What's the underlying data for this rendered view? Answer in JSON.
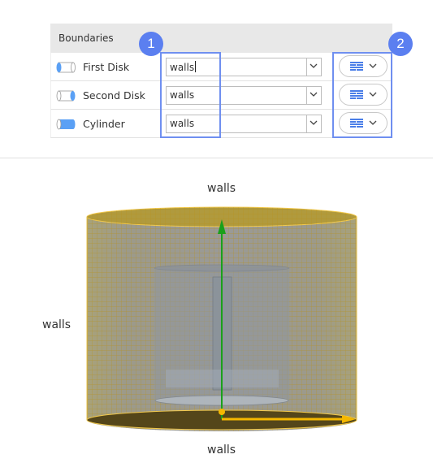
{
  "panel": {
    "header": "Boundaries",
    "rows": [
      {
        "label": "First Disk",
        "icon": "cylinder-first-disk-icon",
        "value": "walls",
        "focused": true
      },
      {
        "label": "Second Disk",
        "icon": "cylinder-second-disk-icon",
        "value": "walls",
        "focused": false
      },
      {
        "label": "Cylinder",
        "icon": "cylinder-side-icon",
        "value": "walls",
        "focused": false
      }
    ],
    "type_button_icon": "wall-brick-icon"
  },
  "callouts": {
    "one": "1",
    "two": "2"
  },
  "viewport": {
    "top_label": "walls",
    "side_label": "walls",
    "bottom_label": "walls"
  },
  "colors": {
    "accent": "#5b7ff0",
    "mesh": "#c8a020",
    "axis_y": "#1aa01a",
    "axis_x": "#f5b800"
  }
}
